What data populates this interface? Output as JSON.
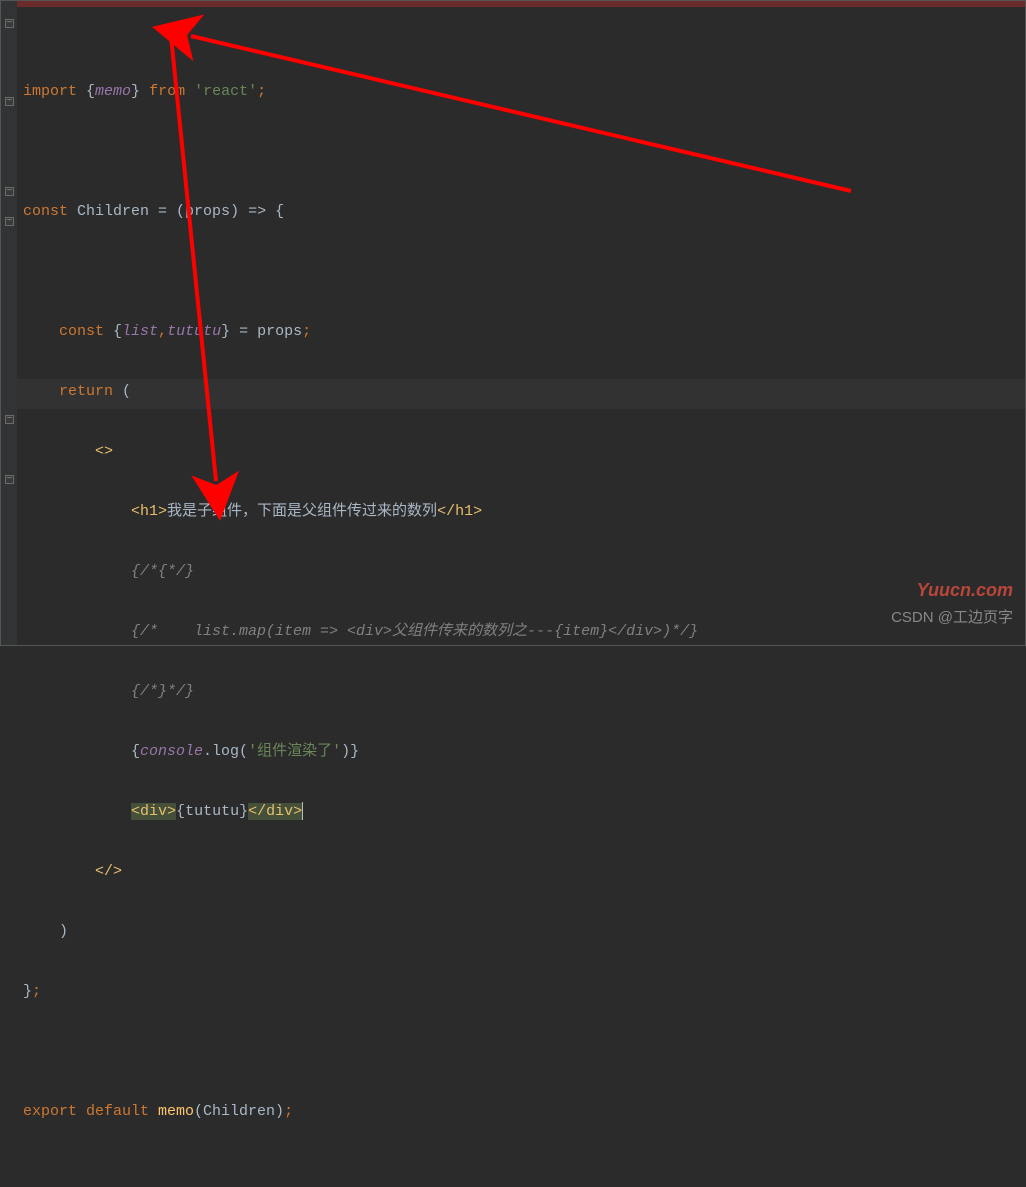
{
  "code": {
    "l1_import": "import",
    "l1_brace_open": " {",
    "l1_memo": "memo",
    "l1_brace_close": "} ",
    "l1_from": "from",
    "l1_react": " 'react'",
    "l1_semi": ";",
    "l3_const": "const ",
    "l3_children": "Children ",
    "l3_eq": "= (",
    "l3_props": "props",
    "l3_arrow": ") => {",
    "l5_const": "    const ",
    "l5_brace": "{",
    "l5_list": "list",
    "l5_comma": ",",
    "l5_tututu": "tututu",
    "l5_close": "} = props",
    "l5_semi": ";",
    "l6_return": "    return ",
    "l6_paren": "(",
    "l7_frag": "        <>",
    "l8_pre": "            ",
    "l8_h1o": "<h1>",
    "l8_text": "我是子组件，下面是父组件传过来的数列",
    "l8_h1c": "</h1>",
    "l9": "            {/*{*/}",
    "l10a": "            {/*    list.map(item => <div>父组件传来的数列之---{item}</div>)*/}",
    "l11": "            {/*}*/}",
    "l12_pre": "            {",
    "l12_console": "console",
    "l12_log": ".log(",
    "l12_str": "'组件渲染了'",
    "l12_close": ")}",
    "l13_pre": "            ",
    "l13_divo": "<div>",
    "l13_brace": "{",
    "l13_tututu": "tututu",
    "l13_braceC": "}",
    "l13_divc": "</div>",
    "l14": "        </>",
    "l15": "    )",
    "l16": "}",
    "l16_semi": ";",
    "l18_export": "export default ",
    "l18_memo": "memo",
    "l18_rest": "(Children)",
    "l18_semi": ";"
  },
  "watermark1": "Yuucn.com",
  "watermark2": "CSDN @工边页字"
}
